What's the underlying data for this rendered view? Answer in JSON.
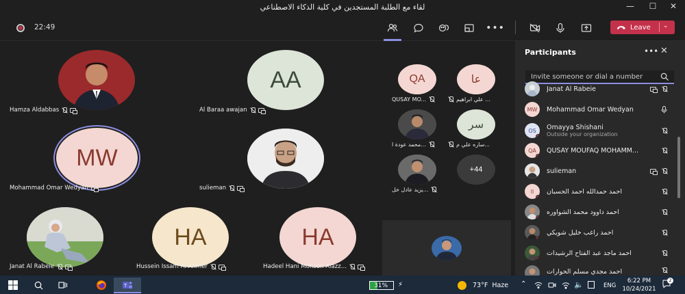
{
  "window": {
    "title": "لقاء مع الطلبة المستجدين في كلية الذكاء الاصطناعي"
  },
  "toolbar": {
    "timer": "22:49",
    "leave_label": "Leave"
  },
  "stage": {
    "tiles": [
      {
        "name": "Hamza Aldabbas",
        "type": "photo"
      },
      {
        "name": "Al Baraa awajan",
        "initials": "AA",
        "bg": "#dde5d8",
        "fg": "#3c4a3a"
      },
      {
        "name": "Mohammad Omar Wedyan",
        "initials": "MW",
        "bg": "#f4d7d2",
        "fg": "#8a3a30"
      },
      {
        "name": "sulieman",
        "type": "photo"
      },
      {
        "name": "Janat Al Rabeie",
        "type": "photo"
      },
      {
        "name": "Hussein Issam Al Ahmer",
        "initials": "HA",
        "bg": "#f5e6cc",
        "fg": "#6b4a1a"
      },
      {
        "name": "Hadeel Hani Mohsen Alazz...",
        "initials": "HA",
        "bg": "#f4d7d2",
        "fg": "#8a3a30"
      }
    ],
    "small_tiles": [
      {
        "name": "QUSAY MO...",
        "initials": "QA",
        "bg": "#f4d7d2",
        "fg": "#8a3a30"
      },
      {
        "name": "علي ابراهيم ...",
        "initials": "عا",
        "bg": "#f4d7d2",
        "fg": "#8a3a30"
      },
      {
        "name": "محمد عودة ا...",
        "type": "photo"
      },
      {
        "name": "ساره علي م...",
        "initials": "سر",
        "bg": "#dde5d8",
        "fg": "#3c4a3a"
      },
      {
        "name": "يزيد عادل خل...",
        "type": "photo"
      },
      {
        "name": "",
        "initials": "+44",
        "bg": "#3b3b3b",
        "fg": "#ffffff"
      }
    ]
  },
  "panel": {
    "title": "Participants",
    "invite_placeholder": "Invite someone or dial a number",
    "participants": [
      {
        "name": "Janat Al Rabeie",
        "type": "photo"
      },
      {
        "name": "Mohammad Omar Wedyan",
        "initials": "MW",
        "bg": "#f4d7d2",
        "fg": "#8a3a30"
      },
      {
        "name": "Omayya Shishani",
        "sub": "Outside your organization",
        "initials": "OS",
        "bg": "#dfe4f4",
        "fg": "#3a4a8a"
      },
      {
        "name": "QUSAY MOUFAQ MOHAMM...",
        "initials": "QA",
        "bg": "#f4d7d2",
        "fg": "#8a3a30"
      },
      {
        "name": "sulieman",
        "type": "photo"
      },
      {
        "name": "احمد حمدالله احمد الحسبان",
        "initials": "اا",
        "bg": "#f4d7d2",
        "fg": "#8a3a30"
      },
      {
        "name": "احمد داوود محمد الشواوره",
        "type": "photo"
      },
      {
        "name": "احمد راغب خليل شويكي",
        "type": "photo"
      },
      {
        "name": "احمد ماجد عبد الفتاح الرشيدات",
        "type": "photo"
      },
      {
        "name": "احمد مجدي مسلم الحوارات",
        "type": "photo"
      }
    ]
  },
  "taskbar": {
    "battery": "31%",
    "weather": "73°F  Haze",
    "lang": "ENG",
    "time": "6:22 PM",
    "date": "10/24/2021"
  }
}
